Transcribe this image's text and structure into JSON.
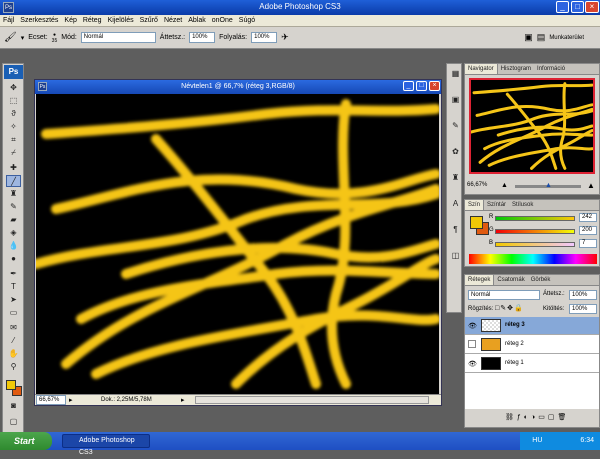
{
  "app": {
    "title": "Adobe Photoshop CS3",
    "logo": "Ps"
  },
  "menu": [
    "Fájl",
    "Szerkesztés",
    "Kép",
    "Réteg",
    "Kijelölés",
    "Szűrő",
    "Nézet",
    "Ablak",
    "onOne",
    "Súgó"
  ],
  "options": {
    "brush_label": "Ecset:",
    "brush_size": "35",
    "mode_label": "Mód:",
    "mode_value": "Normál",
    "opacity_label": "Áttetsz.:",
    "opacity_value": "100%",
    "flow_label": "Folyalás:",
    "flow_value": "100%",
    "workspace_label": "Munkaterület"
  },
  "document": {
    "title": "Névtelen1 @ 66,7% (réteg 3,RGB/8)",
    "zoom": "66,67%",
    "status": "Dok.: 2,25M/5,78M",
    "stroke_color": "#f5c518"
  },
  "navigator": {
    "tabs": [
      "Navigator",
      "Hisztogram",
      "Információ"
    ],
    "zoom": "66,67%"
  },
  "color": {
    "tabs": [
      "Szín",
      "Színtár",
      "Stílusok"
    ],
    "r_label": "R",
    "r_value": "242",
    "g_label": "G",
    "g_value": "200",
    "b_label": "B",
    "b_value": "7",
    "foreground": "#f2c807",
    "background": "#e05a10"
  },
  "layers": {
    "tabs": [
      "Rétegek",
      "Csatornák",
      "Görbék"
    ],
    "blend_mode": "Normál",
    "opacity_label": "Áttetsz.:",
    "opacity_value": "100%",
    "lock_label": "Rögzítés:",
    "fill_label": "Kitöltés:",
    "fill_value": "100%",
    "items": [
      {
        "name": "réteg 3",
        "selected": true
      },
      {
        "name": "réteg 2",
        "selected": false
      },
      {
        "name": "réteg 1",
        "selected": false
      }
    ]
  },
  "taskbar": {
    "start": "Start",
    "task": "Adobe Photoshop CS3",
    "tray_lang": "HU",
    "clock": "6:34"
  }
}
